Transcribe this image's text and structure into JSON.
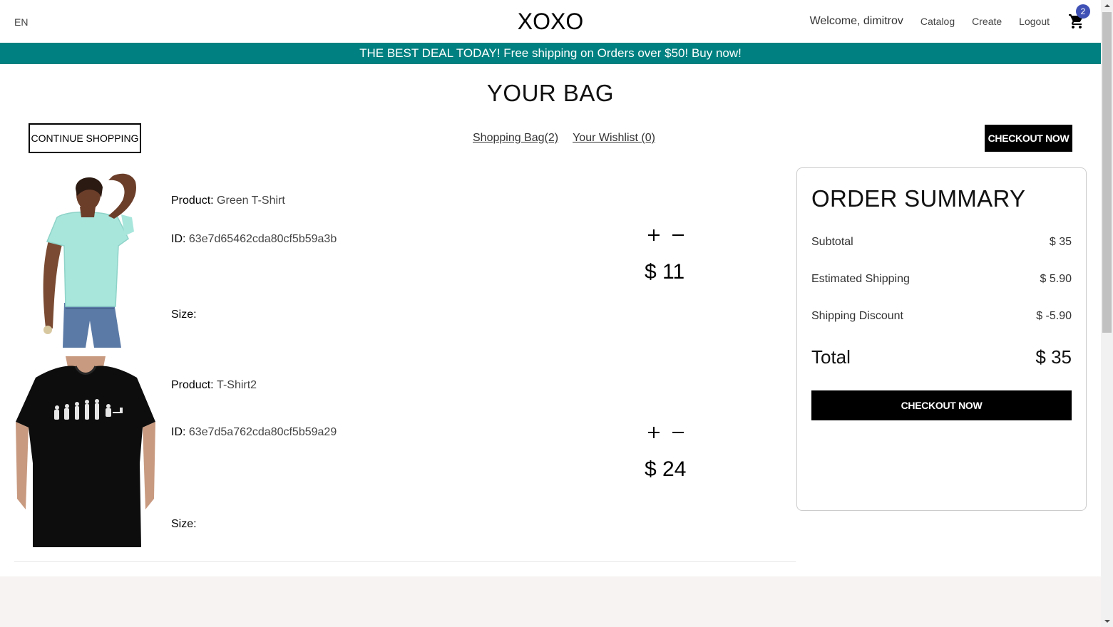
{
  "nav": {
    "lang": "EN",
    "logo": "XOXO",
    "welcome": "Welcome, dimitrov",
    "links": [
      "Catalog",
      "Create",
      "Logout"
    ],
    "cart_count": "2"
  },
  "announcement": "THE BEST DEAL TODAY! Free shipping on Orders over $50! Buy now!",
  "page_title": "YOUR BAG",
  "toolbar": {
    "continue_label": "CONTINUE SHOPPING",
    "bag_link": "Shopping Bag(2)",
    "wishlist_link": "Your Wishlist (0)",
    "checkout_label": "CHECKOUT NOW"
  },
  "products": [
    {
      "product_label": "Product:",
      "name": "Green T-Shirt",
      "id_label": "ID:",
      "id": "63e7d65462cda80cf5b59a3b",
      "size_label": "Size:",
      "price": "$ 11"
    },
    {
      "product_label": "Product:",
      "name": "T-Shirt2",
      "id_label": "ID:",
      "id": "63e7d5a762cda80cf5b59a29",
      "size_label": "Size:",
      "price": "$ 24"
    }
  ],
  "summary": {
    "title": "ORDER SUMMARY",
    "subtotal_label": "Subtotal",
    "subtotal": "$ 35",
    "shipping_label": "Estimated Shipping",
    "shipping": "$ 5.90",
    "discount_label": "Shipping Discount",
    "discount": "$ -5.90",
    "total_label": "Total",
    "total": "$ 35",
    "checkout_label": "CHECKOUT NOW"
  },
  "colors": {
    "announcement_bg": "#008080",
    "badge": "#3f51b5",
    "footer_bg": "#f8f3f3"
  }
}
